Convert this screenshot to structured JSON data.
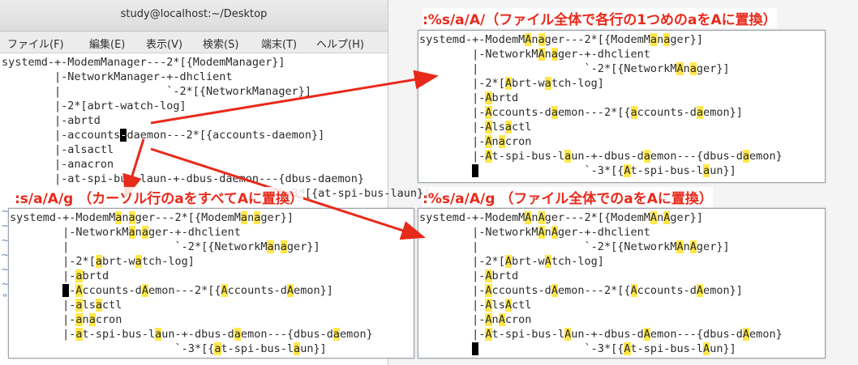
{
  "window": {
    "title": "study@localhost:~/Desktop",
    "menu": [
      "ファイル(F)",
      "編集(E)",
      "表示(V)",
      "検索(S)",
      "端末(T)",
      "ヘルプ(H)"
    ]
  },
  "terminal": {
    "lines": [
      "systemd-+-ModemManager---2*[{ModemManager}]",
      "        |-NetworkManager-+-dhclient",
      "        |                `-2*[{NetworkManager}]",
      "        |-2*[abrt-watch-log]",
      "        |-abrtd",
      "        |-accounts",
      "        |-alsactl",
      "        |-anacron",
      "        |-at-spi-bus-laun-+-dbus-daemon---{dbus-daemon}",
      "                                          `-3*[{at-spi-bus-laun}]"
    ],
    "cursor_line_tail": "daemon---2*[{accounts-daemon}]",
    "cursor_char": "-",
    "tildes": "~\n~\n~\n~\n~\n~\n\""
  },
  "labels": {
    "top_right": ":%s/a/A/（ファイル全体で各行の1つめのaをAに置換）",
    "bottom_left": ":s/a/A/g （カーソル行のaをすべてAに置換）",
    "bottom_right": ":%s/a/A/g （ファイル全体でのaをAに置換）"
  },
  "panels": {
    "top_right": [
      "systemd-+-ModemMAnager---2*[{ModemManager}]",
      "        |-NetworkMAnager-+-dhclient",
      "        |                `-2*[{NetworkMAnager}]",
      "        |-2*[Abrt-watch-log]",
      "        |-Abrtd",
      "        |-Accounts-daemon---2*[{accounts-daemon}]",
      "        |-Alsactl",
      "        |-Anacron",
      "        |-At-spi-bus-laun-+-dbus-daemon---{dbus-daemon}",
      "                         `-3*[{At-spi-bus-laun}]"
    ],
    "bottom_left": [
      "systemd-+-ModemManager---2*[{ModemManager}]",
      "        |-NetworkManager-+-dhclient",
      "        |                `-2*[{NetworkManager}]",
      "        |-2*[abrt-watch-log]",
      "        |-abrtd",
      "        |-Accounts-dAemon---2*[{Accounts-dAemon}]",
      "        |-alsactl",
      "        |-anacron",
      "        |-at-spi-bus-laun-+-dbus-daemon---{dbus-daemon}",
      "                         `-3*[{at-spi-bus-laun}]"
    ],
    "bottom_right": [
      "systemd-+-ModemMAnAger---2*[{ModemMAnAger}]",
      "        |-NetworkMAnAger-+-dhclient",
      "        |                `-2*[{NetworkMAnAger}]",
      "        |-2*[Abrt-wAtch-log]",
      "        |-Abrtd",
      "        |-Accounts-dAemon---2*[{Accounts-dAemon}]",
      "        |-AlsActl",
      "        |-AnAcron",
      "        |-At-spi-bus-lAun-+-dbus-dAemon---{dbus-dAemon}",
      "                         `-3*[{At-spi-bus-lAun}]"
    ]
  },
  "colors": {
    "annotation": "#e82a1b",
    "highlight": "#ffe74a"
  }
}
